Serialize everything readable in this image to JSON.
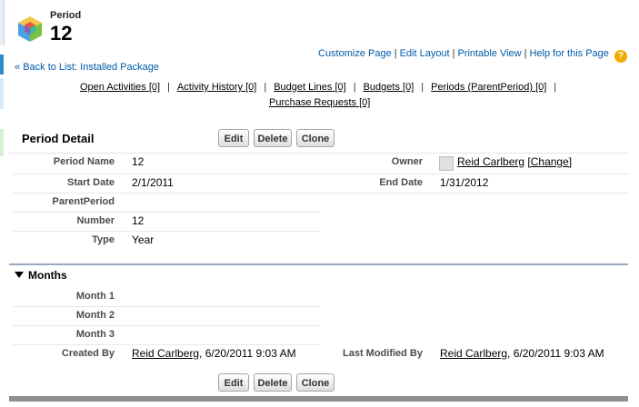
{
  "header": {
    "object_type": "Period",
    "title": "12"
  },
  "help_links": {
    "customize": "Customize Page",
    "edit_layout": "Edit Layout",
    "printable": "Printable View",
    "help": "Help for this Page",
    "separator": "|"
  },
  "back": {
    "prefix": "«",
    "label": "Back to List: Installed Package"
  },
  "related": [
    {
      "label": "Open Activities",
      "count": "[0]"
    },
    {
      "label": "Activity History",
      "count": "[0]"
    },
    {
      "label": "Budget Lines",
      "count": "[0]"
    },
    {
      "label": "Budgets",
      "count": "[0]"
    },
    {
      "label": "Periods (ParentPeriod)",
      "count": "[0]"
    },
    {
      "label": "Purchase Requests",
      "count": "[0]"
    }
  ],
  "related_sep": "|",
  "detail": {
    "title": "Period Detail",
    "buttons": {
      "edit": "Edit",
      "delete": "Delete",
      "clone": "Clone"
    },
    "fields": {
      "period_name": {
        "label": "Period Name",
        "value": "12"
      },
      "owner": {
        "label": "Owner",
        "value": "Reid Carlberg",
        "change": "[Change]"
      },
      "start_date": {
        "label": "Start Date",
        "value": "2/1/2011"
      },
      "end_date": {
        "label": "End Date",
        "value": "1/31/2012"
      },
      "parent_period": {
        "label": "ParentPeriod",
        "value": ""
      },
      "number": {
        "label": "Number",
        "value": "12"
      },
      "type": {
        "label": "Type",
        "value": "Year"
      }
    }
  },
  "months": {
    "title": "Months",
    "fields": {
      "month1": {
        "label": "Month 1",
        "value": ""
      },
      "month2": {
        "label": "Month 2",
        "value": ""
      },
      "month3": {
        "label": "Month 3",
        "value": ""
      }
    },
    "created_by": {
      "label": "Created By",
      "user": "Reid Carlberg",
      "date": ", 6/20/2011 9:03 AM"
    },
    "last_modified_by": {
      "label": "Last Modified By",
      "user": "Reid Carlberg",
      "date": ", 6/20/2011 9:03 AM"
    }
  },
  "bottom_buttons": {
    "edit": "Edit",
    "delete": "Delete",
    "clone": "Clone"
  },
  "colors": {
    "link_blue": "#015ba7",
    "help_icon": "#f0ab00",
    "section_rule": "#9aa7c4"
  },
  "icons": {
    "app": "cube-icon",
    "help": "help-icon",
    "collapse": "triangle-down-icon",
    "avatar": "user-avatar-icon"
  }
}
